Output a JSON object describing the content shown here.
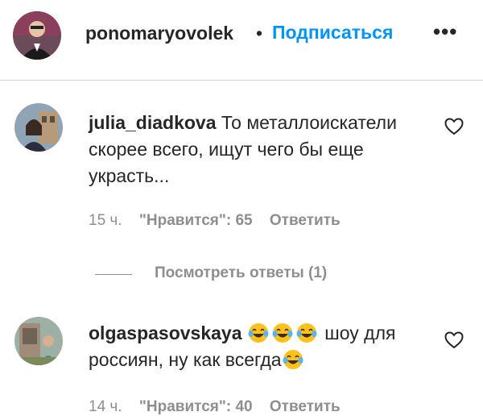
{
  "header": {
    "username": "ponomaryovolek",
    "separator": "•",
    "follow_label": "Подписаться",
    "more_label": "•••"
  },
  "comments": [
    {
      "username": "julia_diadkova",
      "text": "То металлоискатели скорее всего, ищут чего бы еще украсть...",
      "time": "15 ч.",
      "likes": "\"Нравится\": 65",
      "reply": "Ответить",
      "view_replies": "Посмотреть ответы (1)"
    },
    {
      "username": "olgaspasovskaya",
      "text": "шоу для россиян, ну как всегда",
      "emoji_name": "laughing-tears-emoji",
      "time": "14 ч.",
      "likes": "\"Нравится\": 40",
      "reply": "Ответить"
    }
  ],
  "colors": {
    "accent": "#0095f6",
    "text": "#262626",
    "secondary": "#8e8e8e",
    "divider": "#dbdbdb"
  }
}
